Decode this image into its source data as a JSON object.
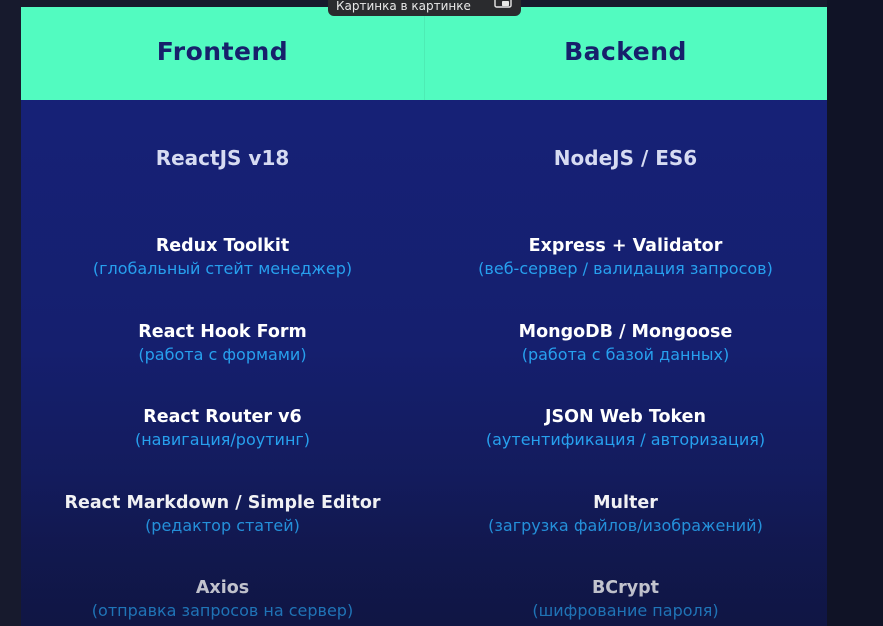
{
  "tooltip": {
    "label": "Картинка в картинке",
    "icon": "picture-in-picture-icon"
  },
  "columns": {
    "frontend": {
      "title": "Frontend",
      "main": "ReactJS v18",
      "items": [
        {
          "name": "Redux Toolkit",
          "desc": "(глобальный стейт менеджер)"
        },
        {
          "name": "React Hook Form",
          "desc": "(работа с формами)"
        },
        {
          "name": "React Router v6",
          "desc": "(навигация/роутинг)"
        },
        {
          "name": "React Markdown / Simple Editor",
          "desc": "(редактор статей)"
        },
        {
          "name": "Axios",
          "desc": "(отправка запросов на сервер)"
        }
      ]
    },
    "backend": {
      "title": "Backend",
      "main": "NodeJS / ES6",
      "items": [
        {
          "name": "Express + Validator",
          "desc": "(веб-сервер / валидация запросов)"
        },
        {
          "name": "MongoDB / Mongoose",
          "desc": "(работа с базой данных)"
        },
        {
          "name": "JSON Web Token",
          "desc": "(аутентификация / авторизация)"
        },
        {
          "name": "Multer",
          "desc": "(загрузка файлов/изображений)"
        },
        {
          "name": "BCrypt",
          "desc": "(шифрование пароля)"
        }
      ]
    }
  },
  "colors": {
    "header_bg": "#52fbc0",
    "header_text": "#17206b",
    "slide_bg": "#16227a",
    "item_name": "#ffffff",
    "item_desc": "#27a0ee"
  }
}
